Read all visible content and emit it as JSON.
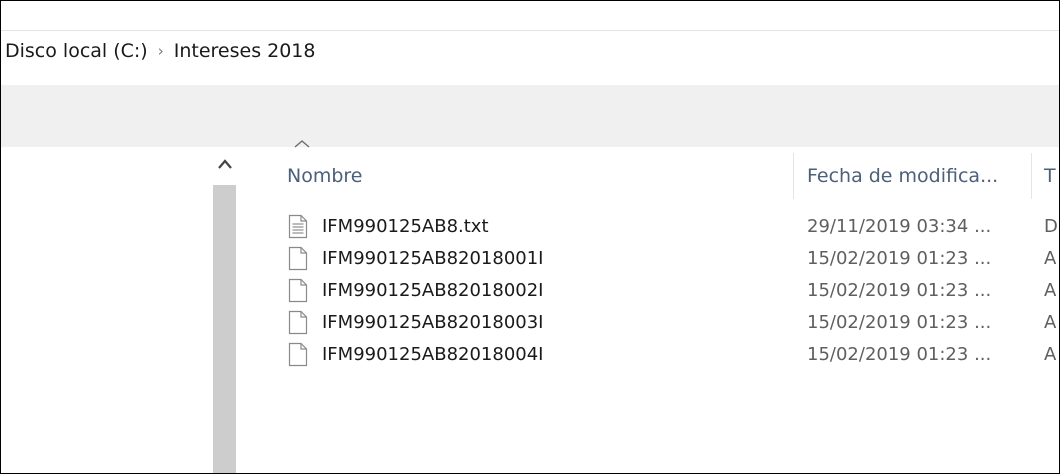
{
  "breadcrumb": {
    "items": [
      "Disco local (C:)",
      "Intereses 2018"
    ],
    "separator": "›"
  },
  "columns": {
    "name": "Nombre",
    "date": "Fecha de modifica...",
    "type": "T"
  },
  "files": [
    {
      "name": "IFM990125AB8.txt",
      "date": "29/11/2019 03:34 ...",
      "type": "D",
      "icon": "text-file-icon"
    },
    {
      "name": "IFM990125AB82018001I",
      "date": "15/02/2019 01:23 ...",
      "type": "A",
      "icon": "blank-file-icon"
    },
    {
      "name": "IFM990125AB82018002I",
      "date": "15/02/2019 01:23 ...",
      "type": "A",
      "icon": "blank-file-icon"
    },
    {
      "name": "IFM990125AB82018003I",
      "date": "15/02/2019 01:23 ...",
      "type": "A",
      "icon": "blank-file-icon"
    },
    {
      "name": "IFM990125AB82018004I",
      "date": "15/02/2019 01:23 ...",
      "type": "A",
      "icon": "blank-file-icon"
    }
  ],
  "colors": {
    "header_text": "#4c607a",
    "band": "#f0f0f0",
    "scroll_thumb": "#cdcdcd"
  }
}
